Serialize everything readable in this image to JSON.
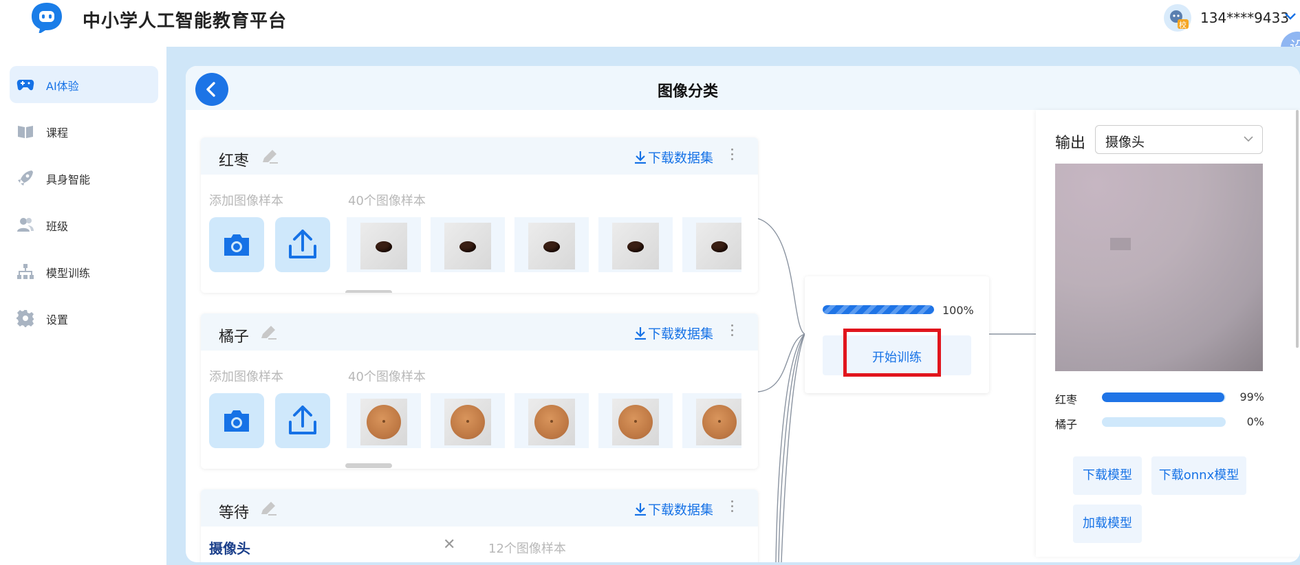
{
  "header": {
    "app_title": "中小学人工智能教育平台",
    "user_name": "134****9433",
    "avatar_badge": "校",
    "float_btn_label": "设"
  },
  "sidebar": {
    "items": [
      {
        "label": "AI体验",
        "icon": "gamepad-icon",
        "active": true
      },
      {
        "label": "课程",
        "icon": "book-icon",
        "active": false
      },
      {
        "label": "具身智能",
        "icon": "rocket-icon",
        "active": false
      },
      {
        "label": "班级",
        "icon": "users-icon",
        "active": false
      },
      {
        "label": "模型训练",
        "icon": "hierarchy-icon",
        "active": false
      },
      {
        "label": "设置",
        "icon": "gear-icon",
        "active": false
      }
    ]
  },
  "page": {
    "title": "图像分类"
  },
  "classes": [
    {
      "name": "红枣",
      "download_label": "下载数据集",
      "add_label": "添加图像样本",
      "count_label": "40个图像样本",
      "sample_kind": "date"
    },
    {
      "name": "橘子",
      "download_label": "下载数据集",
      "add_label": "添加图像样本",
      "count_label": "40个图像样本",
      "sample_kind": "orange"
    },
    {
      "name": "等待",
      "download_label": "下载数据集",
      "camera_label": "摄像头",
      "count_label": "12个图像样本"
    }
  ],
  "training": {
    "progress": 100,
    "progress_label": "100%",
    "train_button": "开始训练"
  },
  "output": {
    "label": "输出",
    "source": "摄像头",
    "results": [
      {
        "name": "红枣",
        "value": 99,
        "value_label": "99%"
      },
      {
        "name": "橘子",
        "value": 0,
        "value_label": "0%"
      }
    ],
    "buttons": {
      "download_model": "下载模型",
      "download_onnx": "下载onnx模型",
      "load_model": "加载模型"
    }
  },
  "colors": {
    "accent": "#1672e6",
    "highlight": "#e1151d",
    "main_bg": "#cfe6f8"
  }
}
